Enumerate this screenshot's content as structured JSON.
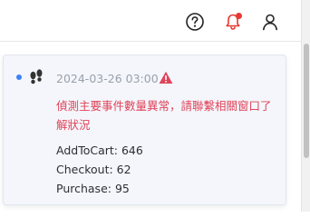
{
  "header": {
    "help_icon": "help-circle-icon",
    "notification_icon": "bell-icon",
    "user_icon": "user-icon",
    "notification_badge_color": "#e53935"
  },
  "notification": {
    "unread": true,
    "type_icon": "footprints-icon",
    "timestamp": "2024-03-26 03:00",
    "severity_icon": "warning-triangle-icon",
    "severity_color": "#e0445a",
    "message": "偵測主要事件數量異常，請聯繫相關窗口了解狀況",
    "metrics": [
      {
        "text": "AddToCart: 646"
      },
      {
        "text": "Checkout: 62"
      },
      {
        "text": "Purchase: 95"
      }
    ]
  },
  "colors": {
    "unread_dot": "#3b82f6",
    "panel_bg": "#f4f6fb",
    "timestamp": "#9aa1ab"
  }
}
